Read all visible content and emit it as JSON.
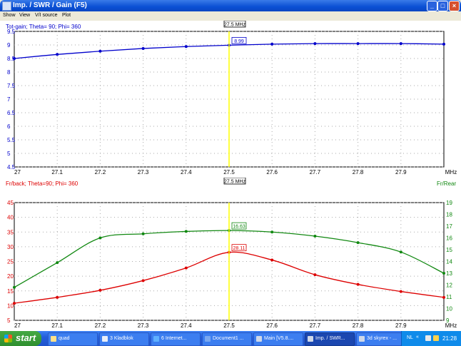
{
  "window": {
    "title": "Imp. / SWR / Gain  (F5)",
    "buttons": {
      "minimize": "_",
      "maximize": "□",
      "close": "×"
    }
  },
  "menu": [
    "Show",
    "View",
    "V/I source",
    "Plot"
  ],
  "cursor_label": "27.5 MHz",
  "unit_label": "MHz",
  "chart_data": [
    {
      "type": "line",
      "title": "Tot-gain; Theta= 90; Phi= 360",
      "xlim": [
        27,
        28
      ],
      "ylim": [
        4.5,
        9.5
      ],
      "x_ticks": [
        "27",
        "27.1",
        "27.2",
        "27.3",
        "27.4",
        "27.5",
        "27.6",
        "27.7",
        "27.8",
        "27.9"
      ],
      "y_ticks": [
        "9.5",
        "9",
        "8.5",
        "8",
        "7.5",
        "7",
        "6.5",
        "6",
        "5.5",
        "5",
        "4.5"
      ],
      "x": [
        27.0,
        27.1,
        27.2,
        27.3,
        27.4,
        27.5,
        27.6,
        27.7,
        27.8,
        27.9,
        28.0
      ],
      "series": [
        {
          "color": "#0000cc",
          "values": [
            8.5,
            8.65,
            8.77,
            8.87,
            8.94,
            8.99,
            9.03,
            9.05,
            9.05,
            9.05,
            9.03
          ]
        }
      ],
      "cursor_x": 27.5,
      "cursor_values": [
        "8.99"
      ],
      "grid": true
    },
    {
      "type": "line",
      "title": "Fr/back; Theta=90; Phi= 360",
      "right_axis_title": "Fr/Rear",
      "xlim": [
        27,
        28
      ],
      "ylim_left": [
        5,
        45
      ],
      "ylim_right": [
        9,
        19
      ],
      "x_ticks": [
        "27",
        "27.1",
        "27.2",
        "27.3",
        "27.4",
        "27.5",
        "27.6",
        "27.7",
        "27.8",
        "27.9"
      ],
      "y_ticks_left": [
        "45",
        "40",
        "35",
        "30",
        "25",
        "20",
        "15",
        "10",
        "5"
      ],
      "y_ticks_right": [
        "19",
        "18",
        "17",
        "16",
        "15",
        "14",
        "13",
        "12",
        "11",
        "10",
        "9"
      ],
      "x": [
        27.0,
        27.1,
        27.2,
        27.3,
        27.4,
        27.5,
        27.6,
        27.7,
        27.8,
        27.9,
        28.0
      ],
      "series": [
        {
          "axis": "left",
          "color": "#dd0000",
          "values": [
            10.8,
            12.8,
            15.2,
            18.5,
            22.8,
            28.11,
            25.5,
            20.5,
            17.2,
            14.8,
            12.8
          ]
        },
        {
          "axis": "right",
          "color": "#118811",
          "values": [
            11.8,
            13.9,
            16.0,
            16.35,
            16.55,
            16.63,
            16.5,
            16.15,
            15.6,
            14.8,
            13.0
          ]
        }
      ],
      "cursor_x": 27.5,
      "cursor_values": [
        "28.11",
        "16.63"
      ],
      "grid": true
    }
  ],
  "taskbar": {
    "start": "start",
    "tasks": [
      "quad",
      "3 Kladblok",
      "6 Internet...",
      "Document1 ...",
      "Main [V5.8....",
      "Imp. / SWR...",
      "3d skyrex - ..."
    ],
    "tray": {
      "lang": "NL",
      "arrow": "«",
      "clock": "21:28"
    }
  }
}
